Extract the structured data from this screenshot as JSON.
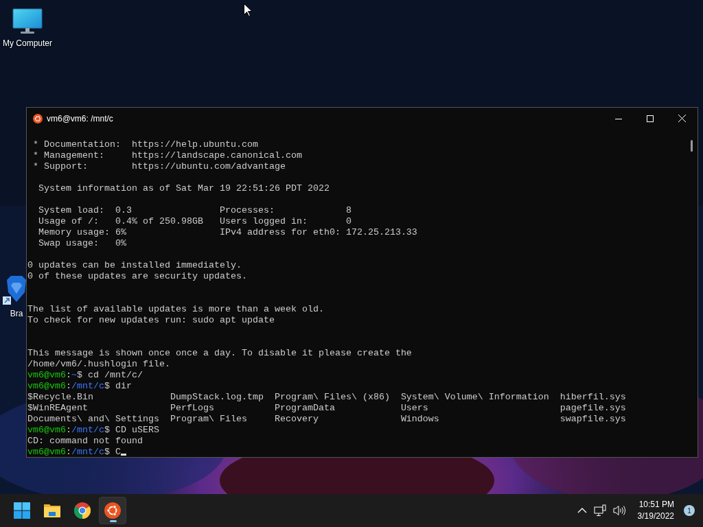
{
  "desktop": {
    "icons": [
      {
        "kind": "computer",
        "label": "My Computer"
      },
      {
        "kind": "brave",
        "label": "Bra"
      }
    ]
  },
  "terminal": {
    "title": "vm6@vm6: /mnt/c",
    "cursor": true,
    "lines": [
      {
        "kind": "text",
        "text": " * Documentation:  https://help.ubuntu.com"
      },
      {
        "kind": "text",
        "text": " * Management:     https://landscape.canonical.com"
      },
      {
        "kind": "text",
        "text": " * Support:        https://ubuntu.com/advantage"
      },
      {
        "kind": "blank"
      },
      {
        "kind": "text",
        "text": "  System information as of Sat Mar 19 22:51:26 PDT 2022"
      },
      {
        "kind": "blank"
      },
      {
        "kind": "text",
        "text": "  System load:  0.3                Processes:             8"
      },
      {
        "kind": "text",
        "text": "  Usage of /:   0.4% of 250.98GB   Users logged in:       0"
      },
      {
        "kind": "text",
        "text": "  Memory usage: 6%                 IPv4 address for eth0: 172.25.213.33"
      },
      {
        "kind": "text",
        "text": "  Swap usage:   0%"
      },
      {
        "kind": "blank"
      },
      {
        "kind": "text",
        "text": "0 updates can be installed immediately."
      },
      {
        "kind": "text",
        "text": "0 of these updates are security updates."
      },
      {
        "kind": "blank"
      },
      {
        "kind": "blank"
      },
      {
        "kind": "text",
        "text": "The list of available updates is more than a week old."
      },
      {
        "kind": "text",
        "text": "To check for new updates run: sudo apt update"
      },
      {
        "kind": "blank"
      },
      {
        "kind": "blank"
      },
      {
        "kind": "text",
        "text": "This message is shown once once a day. To disable it please create the"
      },
      {
        "kind": "text",
        "text": "/home/vm6/.hushlogin file."
      },
      {
        "kind": "prompt",
        "segments": [
          {
            "kind": "user",
            "text": "vm6@vm6"
          },
          {
            "kind": "plain",
            "text": ":"
          },
          {
            "kind": "path",
            "text": "~"
          },
          {
            "kind": "plain",
            "text": "$ cd /mnt/c/"
          }
        ]
      },
      {
        "kind": "prompt",
        "segments": [
          {
            "kind": "user",
            "text": "vm6@vm6"
          },
          {
            "kind": "plain",
            "text": ":"
          },
          {
            "kind": "path",
            "text": "/mnt/c"
          },
          {
            "kind": "plain",
            "text": "$ dir"
          }
        ]
      },
      {
        "kind": "text",
        "text": "$Recycle.Bin              DumpStack.log.tmp  Program\\ Files\\ (x86)  System\\ Volume\\ Information  hiberfil.sys"
      },
      {
        "kind": "text",
        "text": "$WinREAgent               PerfLogs           ProgramData            Users                        pagefile.sys"
      },
      {
        "kind": "text",
        "text": "Documents\\ and\\ Settings  Program\\ Files     Recovery               Windows                      swapfile.sys"
      },
      {
        "kind": "prompt",
        "segments": [
          {
            "kind": "user",
            "text": "vm6@vm6"
          },
          {
            "kind": "plain",
            "text": ":"
          },
          {
            "kind": "path",
            "text": "/mnt/c"
          },
          {
            "kind": "plain",
            "text": "$ CD uSERS"
          }
        ]
      },
      {
        "kind": "text",
        "text": "CD: command not found"
      },
      {
        "kind": "prompt",
        "segments": [
          {
            "kind": "user",
            "text": "vm6@vm6"
          },
          {
            "kind": "plain",
            "text": ":"
          },
          {
            "kind": "path",
            "text": "/mnt/c"
          },
          {
            "kind": "plain",
            "text": "$ C"
          }
        ]
      }
    ]
  },
  "taskbar": {
    "apps": [
      {
        "kind": "start",
        "selected": false
      },
      {
        "kind": "files",
        "selected": false
      },
      {
        "kind": "browser",
        "selected": false
      },
      {
        "kind": "ubuntu",
        "selected": true
      }
    ],
    "time": "10:51 PM",
    "date": "3/19/2022",
    "notifications": "1"
  }
}
